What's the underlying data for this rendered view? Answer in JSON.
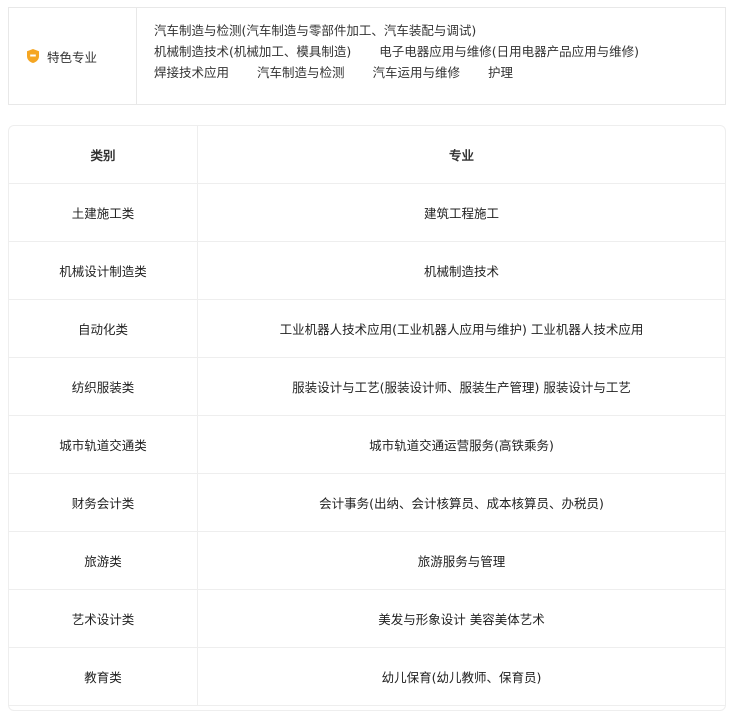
{
  "featured": {
    "label": "特色专业",
    "lines": [
      [
        "汽车制造与检测(汽车制造与零部件加工、汽车装配与调试)"
      ],
      [
        "机械制造技术(机械加工、模具制造)",
        "电子电器应用与维修(日用电器产品应用与维修)"
      ],
      [
        "焊接技术应用",
        "汽车制造与检测",
        "汽车运用与维修",
        "护理"
      ]
    ],
    "icon": "shield-badge-icon",
    "icon_color": "#f5a623"
  },
  "table": {
    "headers": {
      "category": "类别",
      "major": "专业"
    },
    "rows": [
      {
        "category": "土建施工类",
        "major": "建筑工程施工"
      },
      {
        "category": "机械设计制造类",
        "major": "机械制造技术"
      },
      {
        "category": "自动化类",
        "major": "工业机器人技术应用(工业机器人应用与维护)   工业机器人技术应用"
      },
      {
        "category": "纺织服装类",
        "major": "服装设计与工艺(服装设计师、服装生产管理)   服装设计与工艺"
      },
      {
        "category": "城市轨道交通类",
        "major": "城市轨道交通运营服务(高铁乘务)"
      },
      {
        "category": "财务会计类",
        "major": "会计事务(出纳、会计核算员、成本核算员、办税员)"
      },
      {
        "category": "旅游类",
        "major": "旅游服务与管理"
      },
      {
        "category": "艺术设计类",
        "major": "美发与形象设计   美容美体艺术"
      },
      {
        "category": "教育类",
        "major": "幼儿保育(幼儿教师、保育员)"
      }
    ]
  }
}
